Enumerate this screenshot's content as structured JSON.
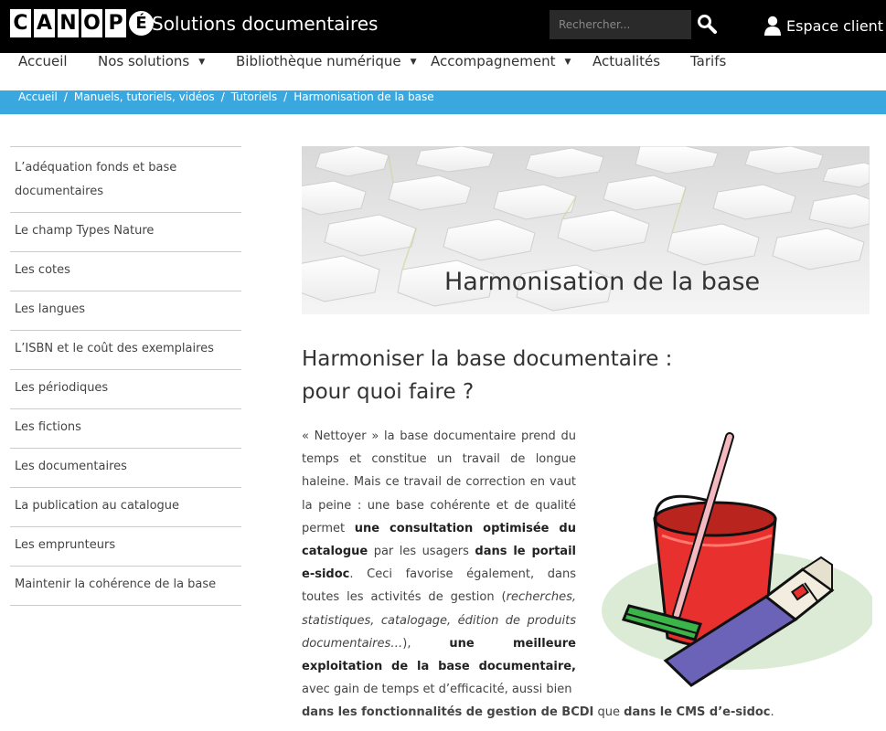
{
  "header": {
    "logo_letters": [
      "C",
      "A",
      "N",
      "O",
      "P",
      "É"
    ],
    "site_title": "Solutions documentaires",
    "search_placeholder": "Rechercher...",
    "client_label": "Espace client"
  },
  "nav": {
    "items": [
      {
        "label": "Accueil"
      },
      {
        "label": "Nos solutions"
      },
      {
        "label": "Bibliothèque numérique"
      },
      {
        "label": "Accompagnement"
      },
      {
        "label": "Actualités"
      },
      {
        "label": "Tarifs"
      }
    ],
    "caret": "▼"
  },
  "breadcrumb": {
    "items": [
      "Accueil",
      "Manuels, tutoriels, vidéos",
      "Tutoriels",
      "Harmonisation de la base"
    ],
    "separator": "/"
  },
  "sidebar": {
    "items": [
      "L’adéquation fonds et base documentaires",
      "Le champ Types Nature",
      "Les cotes",
      "Les langues",
      "L’ISBN et le coût des exemplaires",
      "Les périodiques",
      "Les fictions",
      "Les documentaires",
      "La publication au catalogue",
      "Les emprunteurs",
      "Maintenir la cohérence de la base"
    ]
  },
  "banner": {
    "title": "Harmonisation de la base"
  },
  "content": {
    "heading_line1": "Harmoniser la base documentaire :",
    "heading_line2": "pour quoi faire ?",
    "p1_a": "« Nettoyer » la base documentaire prend du temps et constitue un travail de longue haleine. Mais ce travail de correction en vaut la peine : une base cohérente et de qualité permet ",
    "p1_b": "une consultation optimisée du catalogue",
    "p1_c": " par les usagers ",
    "p1_d": "dans le portail e-sidoc",
    "p1_e": ". Ceci favorise également, dans toutes les activités de gestion (",
    "p1_f": "recherches, statistiques, catalogage, édition de produits documentaires…",
    "p1_g": "), ",
    "p1_h": "une meilleure exploitation de la base documentaire,",
    "p1_i": " avec gain de temps et d’efficacité, aussi bien",
    "p2_a": "dans les fonctionnalités de gestion de BCDI",
    "p2_b": " que ",
    "p2_c": "dans le CMS d’e-sidoc",
    "p2_d": "."
  },
  "colors": {
    "topbar": "#000000",
    "breadcrumb": "#3aa8df",
    "bucket": "#e8312f",
    "handle": "#f3b8c0",
    "wipe": "#6a63b8",
    "splash": "#dcebd5"
  }
}
